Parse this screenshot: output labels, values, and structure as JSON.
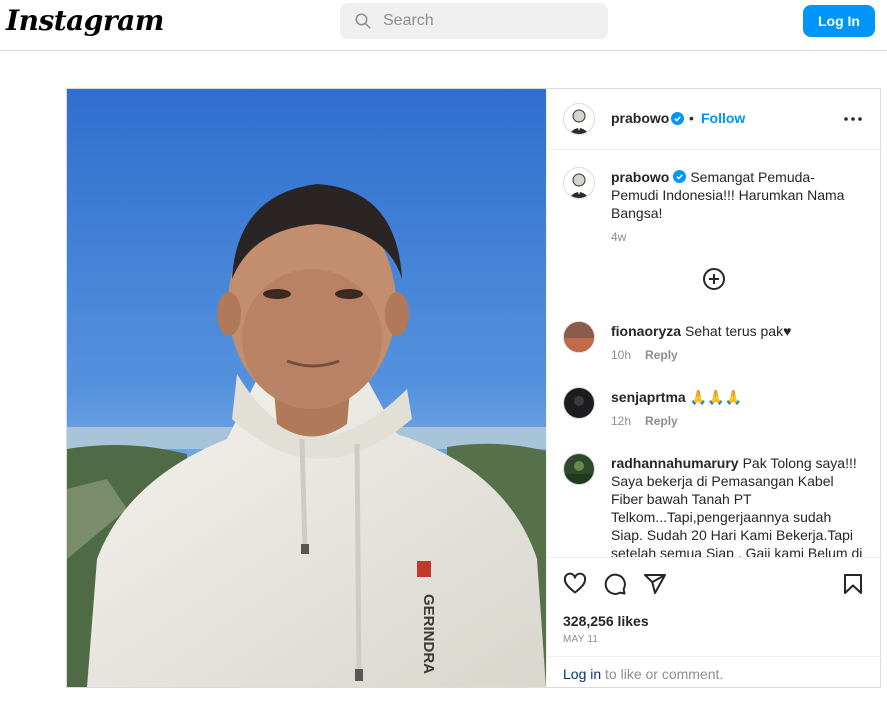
{
  "nav": {
    "logo": "Instagram",
    "search_placeholder": "Search",
    "login_label": "Log In"
  },
  "post": {
    "author": "prabowo",
    "dot": "•",
    "follow_label": "Follow",
    "caption": "Semangat Pemuda-Pemudi Indonesia!!! Harumkan Nama Bangsa!",
    "caption_time": "4w",
    "likes": "328,256 likes",
    "date": "MAY 11",
    "login_link": "Log in",
    "login_suffix": " to like or comment.",
    "hoodie_brand": "GERINDRA"
  },
  "comments": [
    {
      "user": "fionaoryza",
      "text": "Sehat terus pak♥",
      "time": "10h",
      "reply": "Reply"
    },
    {
      "user": "senjaprtma",
      "text": "🙏🙏🙏",
      "time": "12h",
      "reply": "Reply"
    },
    {
      "user": "radhannahumarury",
      "text": "Pak Tolong saya!!! Saya bekerja di Pemasangan Kabel Fiber bawah Tanah PT Telkom...Tapi,pengerjaannya sudah Siap. Sudah 20 Hari Kami Bekerja.Tapi setelah semua Siap , Gaji kami Belum di",
      "time": "",
      "reply": ""
    }
  ],
  "colors": {
    "accent": "#0095f6",
    "sky": "#3b7fd6",
    "hoodie": "#ebe9e3",
    "verified": "#0095f6"
  },
  "icons": [
    "search-icon",
    "verified-badge-icon",
    "more-options-icon",
    "add-circle-icon",
    "heart-icon",
    "comment-icon",
    "share-icon",
    "bookmark-icon"
  ]
}
